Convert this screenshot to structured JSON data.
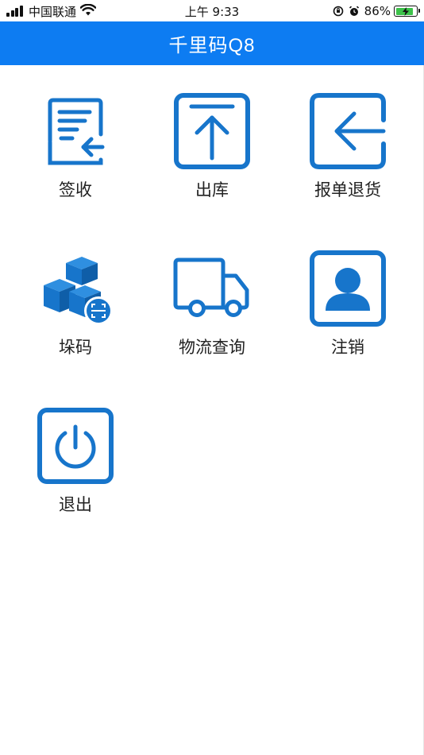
{
  "status_bar": {
    "carrier": "中国联通",
    "time": "上午 9:33",
    "battery_percent": "86%",
    "battery_level": 0.86
  },
  "header": {
    "title": "千里码Q8",
    "background_color": "#0d7cf2"
  },
  "colors": {
    "icon": "#1775cb"
  },
  "menu": {
    "items": [
      {
        "label": "签收",
        "icon": "document-receive-icon"
      },
      {
        "label": "出库",
        "icon": "upload-arrow-icon"
      },
      {
        "label": "报单退货",
        "icon": "return-arrow-icon"
      },
      {
        "label": "垛码",
        "icon": "box-stack-scan-icon"
      },
      {
        "label": "物流查询",
        "icon": "delivery-truck-icon"
      },
      {
        "label": "注销",
        "icon": "user-profile-icon"
      },
      {
        "label": "退出",
        "icon": "power-icon"
      }
    ]
  }
}
